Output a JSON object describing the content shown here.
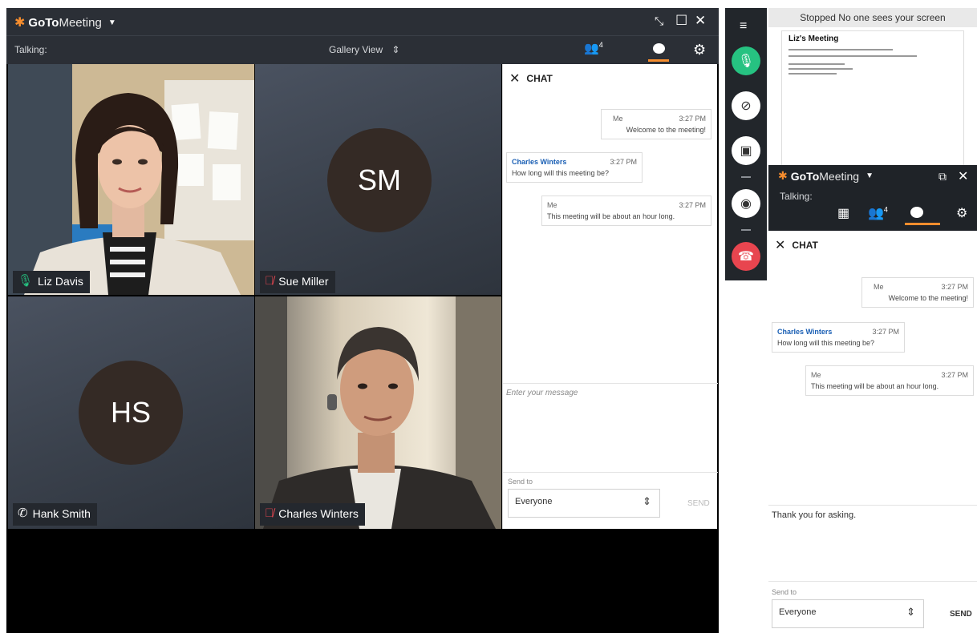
{
  "app": {
    "brand_bold": "GoTo",
    "brand_light": "Meeting",
    "dropdown_caret": "▼",
    "minimize_icon": "⤡",
    "maximize_icon": "☐",
    "close_icon": "✕",
    "restore_icon": "⧉"
  },
  "main_toolbar": {
    "talking_label": "Talking:",
    "view_label": "Gallery View",
    "view_arrows": "⇕",
    "attendees_count": "4"
  },
  "tiles": [
    {
      "name": "Liz Davis",
      "initials": "",
      "audio": "mic-on"
    },
    {
      "name": "Sue Miller",
      "initials": "SM",
      "audio": "mic-muted"
    },
    {
      "name": "Hank Smith",
      "initials": "HS",
      "audio": "phone"
    },
    {
      "name": "Charles Winters",
      "initials": "",
      "audio": "mic-muted"
    }
  ],
  "chat": {
    "title": "CHAT",
    "messages": [
      {
        "sender": "Me",
        "time": "3:27 PM",
        "text": "Welcome to the meeting!"
      },
      {
        "sender": "Charles Winters",
        "time": "3:27 PM",
        "text": "How long will this meeting be?"
      },
      {
        "sender": "Me",
        "time": "3:27 PM",
        "text": "This meeting will be about an hour long."
      }
    ],
    "placeholder": "Enter your message",
    "send_to_label": "Send to",
    "recipient": "Everyone",
    "send_label": "SEND"
  },
  "share_status": "Stopped  No one sees your screen",
  "preview_title": "Liz's Meeting",
  "mini": {
    "talking_label": "Talking:",
    "attendees_count": "4",
    "draft_message": "Thank you for asking."
  },
  "colors": {
    "accent": "#f68d2e",
    "mic_green": "#26c281",
    "hangup_red": "#e8454f",
    "muted_red": "#e0454f",
    "sender_blue": "#1a5fb4"
  }
}
